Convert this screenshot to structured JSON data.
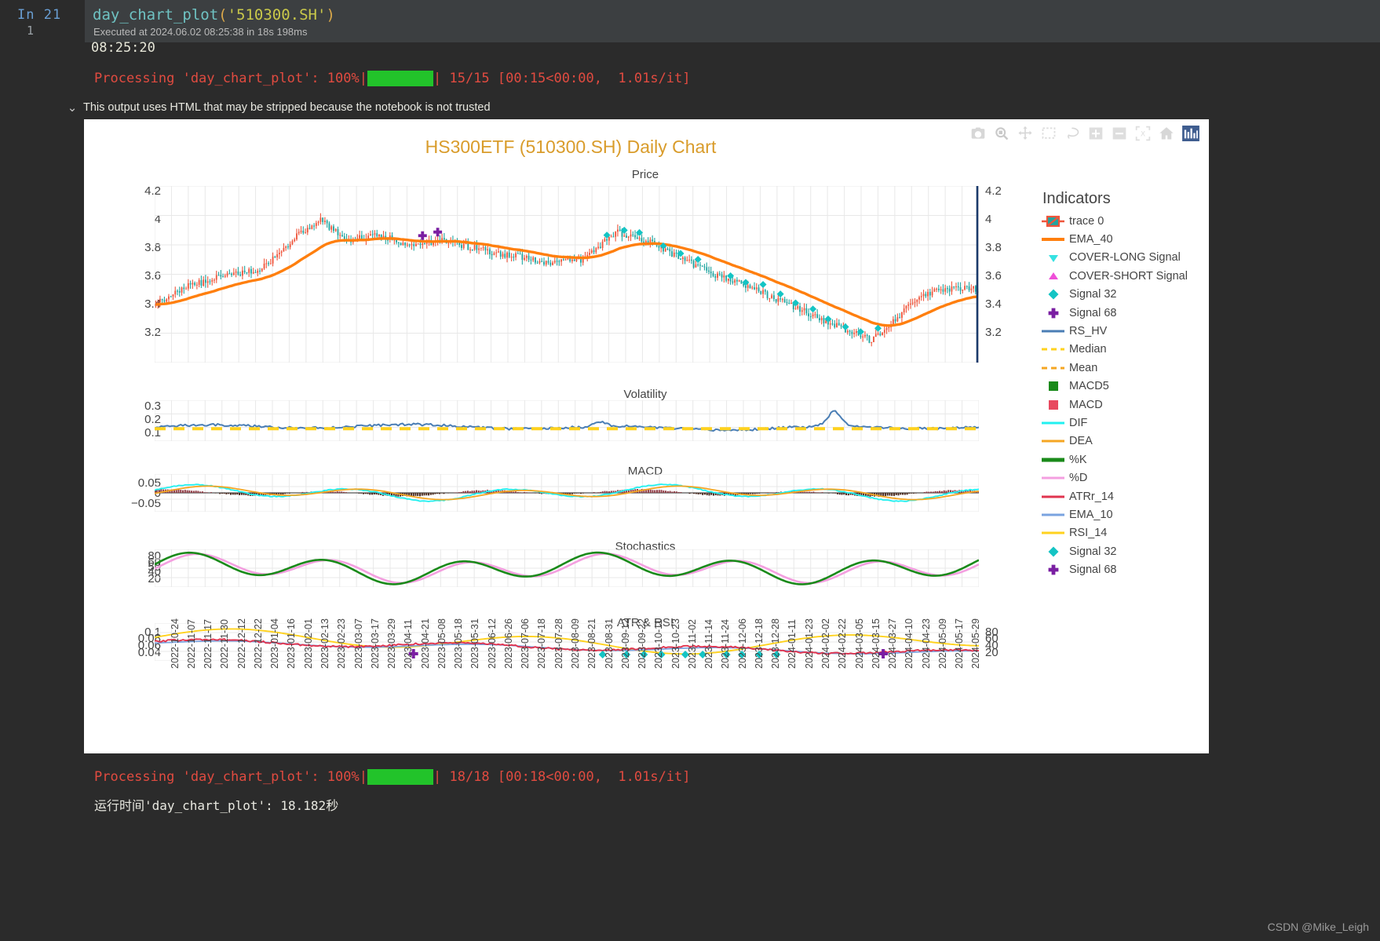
{
  "cell": {
    "prompt_label": "In",
    "exec_count": "21",
    "line_number": "1",
    "code_fn": "day_chart_plot",
    "code_open": "(",
    "code_arg": "'510300.SH'",
    "code_close": ")",
    "exec_info": "Executed at 2024.06.02 08:25:38 in 18s 198ms"
  },
  "output_top": {
    "timestamp": "08:25:20",
    "progress_prefix": "Processing 'day_chart_plot': 100%|",
    "progress_suffix": "| 15/15 [00:15<00:00,  1.01s/it]",
    "progress_percent": "100%",
    "progress_color": "#22c32a"
  },
  "trust_banner": {
    "chevron": "⌄",
    "text": "This output uses HTML that may be stripped because the notebook is not trusted"
  },
  "modebar": {
    "buttons": [
      {
        "name": "camera-icon",
        "title": "Download plot as a png"
      },
      {
        "name": "zoom-icon",
        "title": "Zoom"
      },
      {
        "name": "pan-icon",
        "title": "Pan"
      },
      {
        "name": "box-select-icon",
        "title": "Box Select"
      },
      {
        "name": "lasso-select-icon",
        "title": "Lasso Select"
      },
      {
        "name": "zoom-in-icon",
        "title": "Zoom in"
      },
      {
        "name": "zoom-out-icon",
        "title": "Zoom out"
      },
      {
        "name": "autoscale-icon",
        "title": "Autoscale"
      },
      {
        "name": "reset-axes-icon",
        "title": "Reset axes"
      },
      {
        "name": "plotly-logo-icon",
        "title": "Produced with Plotly"
      }
    ]
  },
  "chart_data": {
    "type": "line",
    "title": "HS300ETF (510300.SH) Daily Chart",
    "title_color": "#d99c2b",
    "legend_title": "Indicators",
    "legend_position": "right",
    "grid": true,
    "subplots": [
      {
        "name": "price",
        "title": "Price",
        "ylabel": "",
        "yticks": [
          "4.2",
          "4",
          "3.8",
          "3.6",
          "3.4",
          "3.2"
        ],
        "yticks_right": [
          "4.2",
          "4",
          "3.8",
          "3.6",
          "3.4",
          "3.2"
        ],
        "ylim": [
          3.1,
          4.3
        ]
      },
      {
        "name": "volatility",
        "title": "Volatility",
        "yticks": [
          "0.3",
          "0.2",
          "0.1"
        ],
        "ylim": [
          0.05,
          0.32
        ]
      },
      {
        "name": "macd",
        "title": "MACD",
        "yticks": [
          "0.05",
          "0",
          "−0.05"
        ],
        "ylim": [
          -0.08,
          0.08
        ]
      },
      {
        "name": "stochastics",
        "title": "Stochastics",
        "yticks": [
          "80",
          "60",
          "50",
          "40",
          "20"
        ],
        "ylim": [
          10,
          95
        ]
      },
      {
        "name": "atr_rsi",
        "title": "ATR & RSI",
        "yticks": [
          "0.1",
          "0.08",
          "0.06",
          "0.04"
        ],
        "yticks_right": [
          "80",
          "60",
          "40",
          "20"
        ],
        "ylim": [
          0.03,
          0.11
        ]
      }
    ],
    "xlabel": "",
    "xticks": [
      "2022-10-24",
      "2022-11-07",
      "2022-11-17",
      "2022-11-30",
      "2022-12-12",
      "2022-12-22",
      "2023-01-04",
      "2023-01-16",
      "2023-02-01",
      "2023-02-13",
      "2023-02-23",
      "2023-03-07",
      "2023-03-17",
      "2023-03-29",
      "2023-04-11",
      "2023-04-21",
      "2023-05-08",
      "2023-05-18",
      "2023-05-31",
      "2023-06-12",
      "2023-06-26",
      "2023-07-06",
      "2023-07-18",
      "2023-07-28",
      "2023-08-09",
      "2023-08-21",
      "2023-08-31",
      "2023-09-12",
      "2023-09-22",
      "2023-10-11",
      "2023-10-23",
      "2023-11-02",
      "2023-11-14",
      "2023-11-24",
      "2023-12-06",
      "2023-12-18",
      "2023-12-28",
      "2024-01-11",
      "2024-01-23",
      "2024-02-02",
      "2024-02-22",
      "2024-03-05",
      "2024-03-15",
      "2024-03-27",
      "2024-04-10",
      "2024-04-23",
      "2024-05-09",
      "2024-05-17",
      "2024-05-29"
    ],
    "series": [
      {
        "name": "trace 0",
        "symbol": "candlestick",
        "color_up": "#ef553b",
        "color_down": "#20a5a0"
      },
      {
        "name": "EMA_40",
        "symbol": "line",
        "color": "#ff7f0e",
        "width": 4
      },
      {
        "name": "COVER-LONG Signal",
        "symbol": "triangle-down",
        "color": "#35e2e2"
      },
      {
        "name": "COVER-SHORT Signal",
        "symbol": "triangle-up",
        "color": "#ef4fd8"
      },
      {
        "name": "Signal 32",
        "symbol": "diamond",
        "color": "#14c4c4"
      },
      {
        "name": "Signal 68",
        "symbol": "cross",
        "color": "#7a1fa2"
      },
      {
        "name": "RS_HV",
        "symbol": "line",
        "color": "#4a7eb5",
        "width": 3
      },
      {
        "name": "Median",
        "symbol": "dashed-line",
        "color": "#ffd21e",
        "width": 3
      },
      {
        "name": "Mean",
        "symbol": "dashed-line",
        "color": "#f5a623",
        "width": 3
      },
      {
        "name": "MACD5",
        "symbol": "square",
        "color": "#1a8a1a"
      },
      {
        "name": "MACD",
        "symbol": "square",
        "color": "#e8495f"
      },
      {
        "name": "DIF",
        "symbol": "line",
        "color": "#21f0f0",
        "width": 3
      },
      {
        "name": "DEA",
        "symbol": "line",
        "color": "#f5a623",
        "width": 3
      },
      {
        "name": "%K",
        "symbol": "line",
        "color": "#1a8a1a",
        "width": 5
      },
      {
        "name": "%D",
        "symbol": "line",
        "color": "#f49fe0",
        "width": 3
      },
      {
        "name": "ATRr_14",
        "symbol": "line",
        "color": "#e0344f",
        "width": 3
      },
      {
        "name": "EMA_10",
        "symbol": "line",
        "color": "#7aa3e0",
        "width": 3
      },
      {
        "name": "RSI_14",
        "symbol": "line",
        "color": "#ffd21e",
        "width": 3
      },
      {
        "name": "Signal 32",
        "symbol": "diamond",
        "color": "#14c4c4"
      },
      {
        "name": "Signal 68",
        "symbol": "cross",
        "color": "#7a1fa2"
      }
    ]
  },
  "output_bottom": {
    "progress_prefix": "Processing 'day_chart_plot': 100%|",
    "progress_suffix": "| 18/18 [00:18<00:00,  1.01s/it]",
    "runtime_text": "运行时间'day_chart_plot': 18.182秒"
  },
  "watermark": "CSDN @Mike_Leigh"
}
